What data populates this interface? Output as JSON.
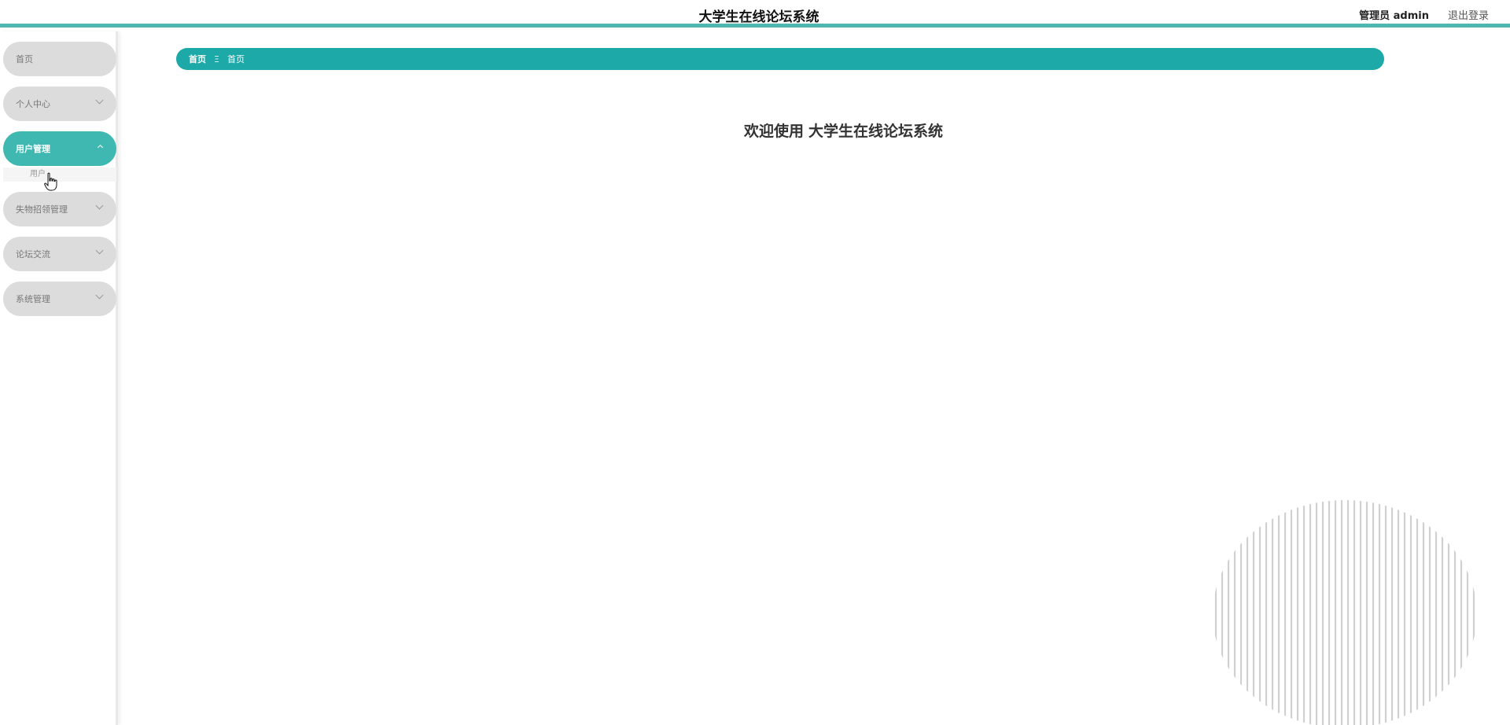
{
  "header": {
    "title": "大学生在线论坛系统",
    "admin_label": "管理员 admin",
    "logout": "退出登录"
  },
  "sidebar": {
    "items": [
      {
        "label": "首页",
        "expandable": false,
        "active": false
      },
      {
        "label": "个人中心",
        "expandable": true,
        "active": false
      },
      {
        "label": "用户管理",
        "expandable": true,
        "active": true
      },
      {
        "label": "失物招领管理",
        "expandable": true,
        "active": false
      },
      {
        "label": "论坛交流",
        "expandable": true,
        "active": false
      },
      {
        "label": "系统管理",
        "expandable": true,
        "active": false
      }
    ],
    "submenu_label": "用户"
  },
  "breadcrumb": {
    "home": "首页",
    "separator": "Ξ",
    "current": "首页"
  },
  "main": {
    "welcome_prefix": "欢迎使用",
    "welcome_name": "大学生在线论坛系统"
  },
  "colors": {
    "accent": "#1ca9a8",
    "active_menu": "#3eb8b1",
    "menu_bg": "#dcdcdc",
    "header_border": "#4fb7b0"
  },
  "icons": {
    "cursor": "hand-pointer-icon",
    "chevron": "chevron-down-icon"
  }
}
